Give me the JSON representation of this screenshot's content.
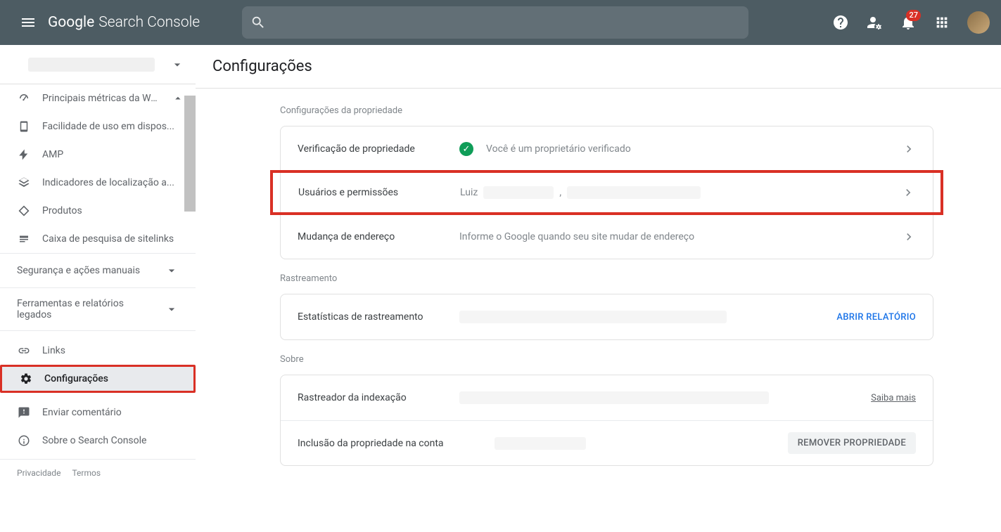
{
  "header": {
    "logo_google": "Google",
    "logo_product": "Search Console",
    "notification_count": "27"
  },
  "sidebar": {
    "items": [
      {
        "label": "Principais métricas da Web",
        "icon": "gauge"
      },
      {
        "label": "Facilidade de uso em dispos...",
        "icon": "phone"
      },
      {
        "label": "AMP",
        "icon": "bolt"
      },
      {
        "label": "Indicadores de localização a...",
        "icon": "layers"
      },
      {
        "label": "Produtos",
        "icon": "diamond"
      },
      {
        "label": "Caixa de pesquisa de sitelinks",
        "icon": "search-box"
      }
    ],
    "groups": [
      {
        "label": "Segurança e ações manuais"
      },
      {
        "label": "Ferramentas e relatórios legados"
      }
    ],
    "bottom": [
      {
        "label": "Links",
        "icon": "links"
      },
      {
        "label": "Configurações",
        "icon": "gear",
        "selected": true
      },
      {
        "label": "Enviar comentário",
        "icon": "feedback"
      },
      {
        "label": "Sobre o Search Console",
        "icon": "info"
      }
    ],
    "footer": {
      "privacy": "Privacidade",
      "terms": "Termos"
    }
  },
  "main": {
    "title": "Configurações",
    "sections": {
      "property": {
        "label": "Configurações da propriedade",
        "rows": {
          "verify": {
            "label": "Verificação de propriedade",
            "status": "Você é um proprietário verificado"
          },
          "users": {
            "label": "Usuários e permissões",
            "value": "Luiz"
          },
          "address": {
            "label": "Mudança de endereço",
            "hint": "Informe o Google quando seu site mudar de endereço"
          }
        }
      },
      "crawl": {
        "label": "Rastreamento",
        "rows": {
          "stats": {
            "label": "Estatísticas de rastreamento",
            "action": "ABRIR RELATÓRIO"
          }
        }
      },
      "about": {
        "label": "Sobre",
        "rows": {
          "crawler": {
            "label": "Rastreador da indexação",
            "link": "Saiba mais"
          },
          "inclusion": {
            "label": "Inclusão da propriedade na conta",
            "button": "REMOVER PROPRIEDADE"
          }
        }
      }
    }
  }
}
